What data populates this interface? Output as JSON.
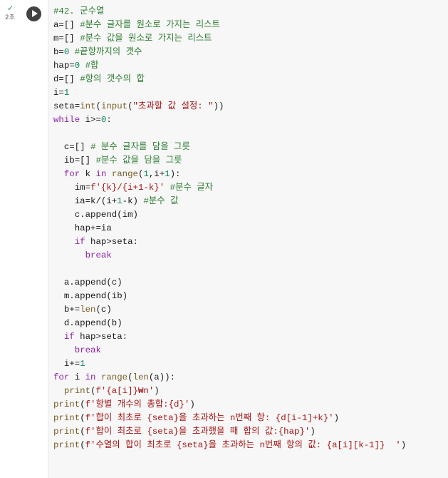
{
  "cell": {
    "status_icon": "check-icon",
    "exec_time": "2초",
    "run_icon": "play-icon",
    "lines": [
      [
        [
          "#42. 군수열",
          "com"
        ]
      ],
      [
        [
          "a=[] ",
          ""
        ],
        [
          "#분수 글자를 원소로 가지는 리스트",
          "com"
        ]
      ],
      [
        [
          "m=[] ",
          ""
        ],
        [
          "#분수 값을 원소로 가지는 리스트",
          "com"
        ]
      ],
      [
        [
          "b=",
          ""
        ],
        [
          "0",
          "num"
        ],
        [
          " ",
          ""
        ],
        [
          "#끝항까지의 갯수",
          "com"
        ]
      ],
      [
        [
          "hap=",
          ""
        ],
        [
          "0",
          "num"
        ],
        [
          " ",
          ""
        ],
        [
          "#합",
          "com"
        ]
      ],
      [
        [
          "d=[] ",
          ""
        ],
        [
          "#항의 갯수의 합",
          "com"
        ]
      ],
      [
        [
          "i=",
          ""
        ],
        [
          "1",
          "num"
        ]
      ],
      [
        [
          "seta=",
          ""
        ],
        [
          "int",
          "fn"
        ],
        [
          "(",
          ""
        ],
        [
          "input",
          "fn"
        ],
        [
          "(",
          ""
        ],
        [
          "\"초과할 값 설정: \"",
          "str"
        ],
        [
          "))",
          ""
        ]
      ],
      [
        [
          "while",
          "kw"
        ],
        [
          " i>=",
          ""
        ],
        [
          "0",
          "num"
        ],
        [
          ":",
          ""
        ]
      ],
      [],
      [
        [
          "  c=[] ",
          ""
        ],
        [
          "# 분수 글자를 담을 그릇",
          "com"
        ]
      ],
      [
        [
          "  ib=[] ",
          ""
        ],
        [
          "#분수 값을 담을 그릇",
          "com"
        ]
      ],
      [
        [
          "  ",
          ""
        ],
        [
          "for",
          "kw"
        ],
        [
          " k ",
          ""
        ],
        [
          "in",
          "kw"
        ],
        [
          " ",
          ""
        ],
        [
          "range",
          "fn"
        ],
        [
          "(",
          ""
        ],
        [
          "1",
          "num"
        ],
        [
          ",i+",
          ""
        ],
        [
          "1",
          "num"
        ],
        [
          "):",
          ""
        ]
      ],
      [
        [
          "    im=",
          ""
        ],
        [
          "f'{k}/{i+1-k}'",
          "str"
        ],
        [
          " ",
          ""
        ],
        [
          "#분수 글자",
          "com"
        ]
      ],
      [
        [
          "    ia=k/(i+",
          ""
        ],
        [
          "1",
          "num"
        ],
        [
          "-k) ",
          ""
        ],
        [
          "#분수 값",
          "com"
        ]
      ],
      [
        [
          "    c.append(im)",
          ""
        ]
      ],
      [
        [
          "    hap+=ia",
          ""
        ]
      ],
      [
        [
          "    ",
          ""
        ],
        [
          "if",
          "kw"
        ],
        [
          " hap>seta:",
          ""
        ]
      ],
      [
        [
          "      ",
          ""
        ],
        [
          "break",
          "kw"
        ]
      ],
      [],
      [
        [
          "  a.append(c)",
          ""
        ]
      ],
      [
        [
          "  m.append(ib)",
          ""
        ]
      ],
      [
        [
          "  b+=",
          ""
        ],
        [
          "len",
          "fn"
        ],
        [
          "(c)",
          ""
        ]
      ],
      [
        [
          "  d.append(b)",
          ""
        ]
      ],
      [
        [
          "  ",
          ""
        ],
        [
          "if",
          "kw"
        ],
        [
          " hap>seta:",
          ""
        ]
      ],
      [
        [
          "    ",
          ""
        ],
        [
          "break",
          "kw"
        ]
      ],
      [
        [
          "  i+=",
          ""
        ],
        [
          "1",
          "num"
        ]
      ],
      [
        [
          "for",
          "kw"
        ],
        [
          " i ",
          ""
        ],
        [
          "in",
          "kw"
        ],
        [
          " ",
          ""
        ],
        [
          "range",
          "fn"
        ],
        [
          "(",
          ""
        ],
        [
          "len",
          "fn"
        ],
        [
          "(a)):",
          ""
        ]
      ],
      [
        [
          "  ",
          ""
        ],
        [
          "print",
          "fn"
        ],
        [
          "(",
          ""
        ],
        [
          "f'{a[i]}₩n'",
          "str"
        ],
        [
          ")",
          ""
        ]
      ],
      [
        [
          "print",
          "fn"
        ],
        [
          "(",
          ""
        ],
        [
          "f'항별 개수의 총합:{d}'",
          "str"
        ],
        [
          ")",
          ""
        ]
      ],
      [
        [
          "print",
          "fn"
        ],
        [
          "(",
          ""
        ],
        [
          "f'합이 최초로 {seta}을 초과하는 n번째 항: {d[i-1]+k}'",
          "str"
        ],
        [
          ")",
          ""
        ]
      ],
      [
        [
          "print",
          "fn"
        ],
        [
          "(",
          ""
        ],
        [
          "f'합이 최초로 {seta}을 초과했을 때 합의 값:{hap}'",
          "str"
        ],
        [
          ")",
          ""
        ]
      ],
      [
        [
          "print",
          "fn"
        ],
        [
          "(",
          ""
        ],
        [
          "f'수열의 합이 최초로 {seta}을 초과하는 n번째 항의 값: {a[i][k-1]}  '",
          "str"
        ],
        [
          ")",
          ""
        ]
      ]
    ]
  }
}
